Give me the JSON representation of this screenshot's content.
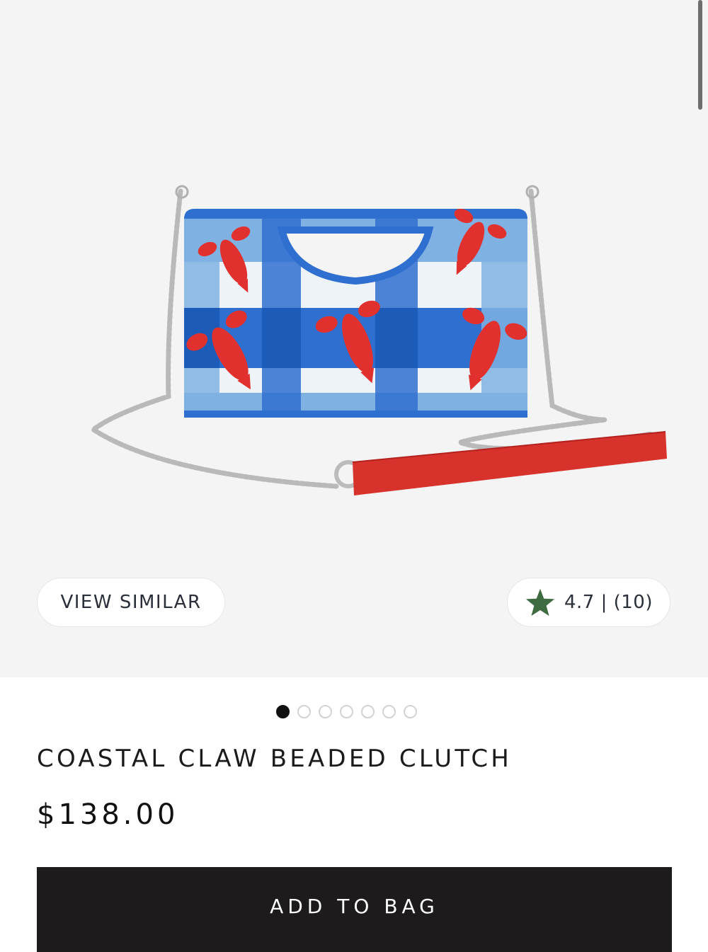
{
  "hero": {
    "image_alt": "Coastal Claw Beaded Clutch product image",
    "view_similar_label": "VIEW SIMILAR",
    "rating_text": "4.7 | (10)",
    "rating_star_color": "#3e6b42"
  },
  "gallery": {
    "total_images": 7,
    "active_index": 0
  },
  "product": {
    "title": "COASTAL CLAW BEADED CLUTCH",
    "price": "$138.00"
  },
  "cta": {
    "add_to_bag_label": "ADD TO BAG"
  },
  "colors": {
    "hero_bg": "#f4f4f4",
    "button_bg": "#1d1b1c",
    "gingham_blue": "#2f6fd0",
    "lobster_red": "#e0312e"
  }
}
